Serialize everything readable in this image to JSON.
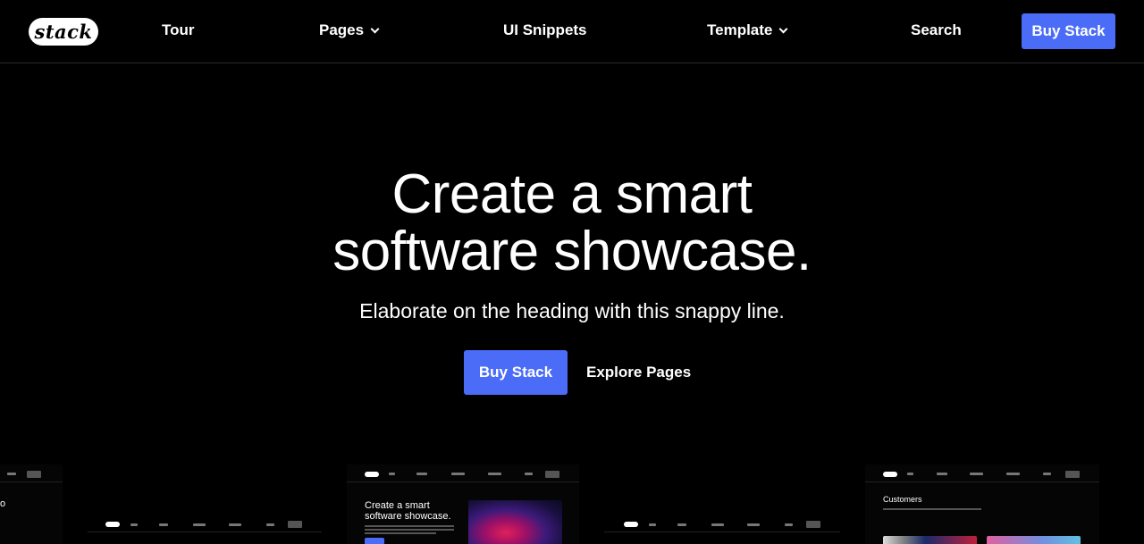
{
  "header": {
    "logo": "stack",
    "nav": [
      {
        "label": "Tour"
      },
      {
        "label": "Pages"
      },
      {
        "label": "UI Snippets"
      },
      {
        "label": "Template"
      },
      {
        "label": "Search"
      }
    ],
    "cta": "Buy Stack"
  },
  "hero": {
    "title_line1": "Create a smart",
    "title_line2": "software showcase.",
    "subtitle": "Elaborate on the heading with this snappy line.",
    "primary_button": "Buy Stack",
    "secondary_link": "Explore Pages"
  },
  "previews": {
    "left_fragment": "o",
    "center_title_line1": "Create a smart",
    "center_title_line2": "software showcase.",
    "right_title": "Customers"
  },
  "colors": {
    "accent": "#4a6cf7",
    "background": "#000000"
  }
}
